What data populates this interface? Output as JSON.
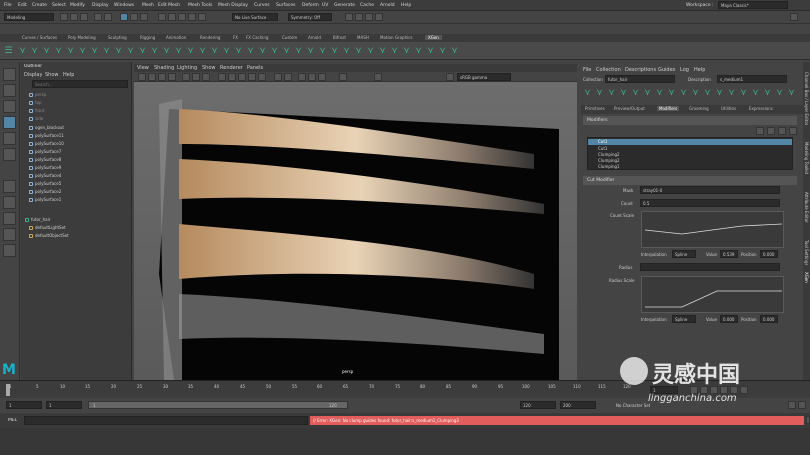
{
  "menubar": {
    "items": [
      "File",
      "Edit",
      "Create",
      "Select",
      "Modify",
      "Display",
      "Windows",
      "Mesh",
      "Edit Mesh",
      "Mesh Tools",
      "Mesh Display",
      "Curves",
      "Surfaces",
      "Deform",
      "UV",
      "Generate",
      "Cache",
      "Arnold",
      "Help"
    ],
    "workspace_label": "Workspace :",
    "workspace_value": "Maya Classic*"
  },
  "statusline": {
    "mode": "Modeling",
    "live_surface": "No Live Surface",
    "symmetry": "Symmetry: Off"
  },
  "shelf_tabs": [
    "Curves / Surfaces",
    "Poly Modeling",
    "Sculpting",
    "Rigging",
    "Animation",
    "Rendering",
    "FX",
    "FX Caching",
    "Custom",
    "Arnold",
    "Bifrost",
    "MASH",
    "Motion Graphics",
    "XGen"
  ],
  "outliner": {
    "title": "Outliner",
    "menu": [
      "Display",
      "Show",
      "Help"
    ],
    "search_placeholder": "Search...",
    "items": [
      "persp",
      "top",
      "front",
      "side",
      "ogen_blockout",
      "polySurface11",
      "polySurface10",
      "polySurface7",
      "polySurface8",
      "polySurface9",
      "polySurface4",
      "polySurface5",
      "polySurface2",
      "polySurface1",
      "futor_hair",
      "defaultLightSet",
      "defaultObjectSet"
    ]
  },
  "viewport": {
    "menu": [
      "View",
      "Shading",
      "Lighting",
      "Show",
      "Renderer",
      "Panels"
    ],
    "color_space": "sRGB gamma",
    "camera_label": "persp"
  },
  "xgen": {
    "menu": [
      "File",
      "Collection",
      "Descriptions",
      "Guides",
      "Log",
      "Help"
    ],
    "collection_label": "Collection",
    "collection_value": "futor_hair",
    "description_label": "Description",
    "description_value": "s_medium1",
    "tabs": [
      "Primitives",
      "Preview/Output",
      "Modifiers",
      "Grooming",
      "Utilities",
      "Expressions"
    ],
    "modifiers_title": "Modifiers",
    "modifier_list": [
      "Cut1",
      "Cut1",
      "Clumping2",
      "Clumping2",
      "Clumping1"
    ],
    "cut_modifier_title": "Cut Modifier",
    "mask_label": "Mask",
    "mask_value": "stray01-0",
    "count_label": "Count",
    "count_value": "0.5",
    "count_scale_label": "Count Scale",
    "interp_label": "Interpolation",
    "interp_value": "Spline",
    "value_label": "Value",
    "value1": "0.539",
    "position_label": "Position",
    "position1": "0.000",
    "radius_label": "Radius",
    "radius_scale_label": "Radius Scale",
    "value2": "0.000",
    "position2": "0.000"
  },
  "side_strip": [
    "Channel Box / Layer Editor",
    "Modeling Toolkit",
    "Attribute Editor",
    "Tool Settings",
    "XGen"
  ],
  "timeline": {
    "ticks": [
      "1",
      "5",
      "10",
      "15",
      "20",
      "25",
      "30",
      "35",
      "40",
      "45",
      "50",
      "55",
      "60",
      "65",
      "70",
      "75",
      "80",
      "85",
      "90",
      "95",
      "100",
      "105",
      "110",
      "115",
      "120"
    ],
    "current_frame": "1"
  },
  "range": {
    "start": "1",
    "inner_start": "1",
    "inner_end": "120",
    "end": "120",
    "max_end": "200",
    "character_set": "No Character Set"
  },
  "cmdline": {
    "lang": "MEL",
    "error": "// Error: XGen: No clump guides found: futor_hair:s_medium1_Clumping3"
  },
  "watermark": {
    "brand": "灵感中国",
    "url": "lingganchina.com"
  },
  "colors": {
    "accent": "#5285a6",
    "error": "#e35d5d",
    "xgen_green": "#3fb38a"
  }
}
